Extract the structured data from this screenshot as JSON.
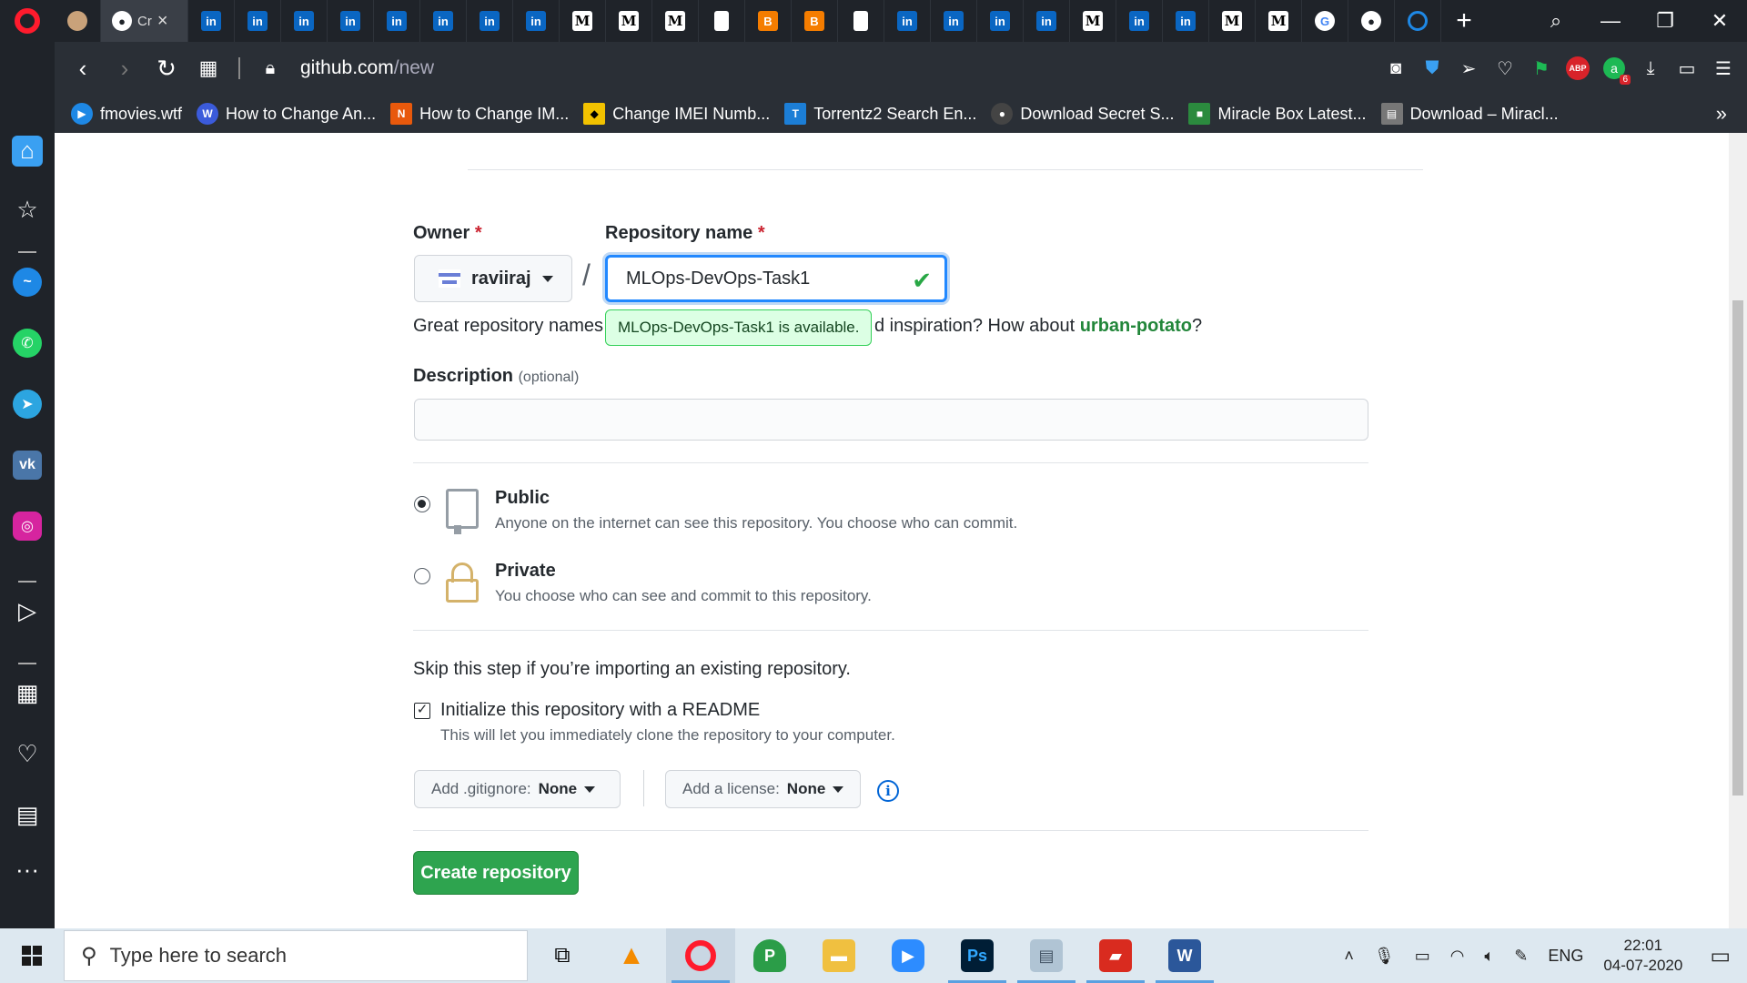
{
  "browser": {
    "active_tab_label": "Cr",
    "url_host": "github.com",
    "url_path": "/new",
    "extension_badge": "6",
    "abp_label": "ABP"
  },
  "tabs": [
    "avatar",
    "github",
    "linkedin",
    "linkedin",
    "linkedin",
    "linkedin",
    "linkedin",
    "linkedin",
    "linkedin",
    "linkedin",
    "medium",
    "medium",
    "medium",
    "doc",
    "blogger",
    "blogger",
    "doc",
    "linkedin",
    "linkedin",
    "linkedin",
    "linkedin",
    "medium",
    "linkedin",
    "linkedin",
    "medium",
    "medium",
    "google",
    "github",
    "power"
  ],
  "bookmarks": [
    {
      "label": "fmovies.wtf",
      "color": "#1e88e5"
    },
    {
      "label": "How to Change An...",
      "color": "#3b5bdb"
    },
    {
      "label": "How to Change IM...",
      "color": "#e8590c"
    },
    {
      "label": "Change IMEI Numb...",
      "color": "#f2c200"
    },
    {
      "label": "Torrentz2 Search En...",
      "color": "#1c7ed6"
    },
    {
      "label": "Download Secret S...",
      "color": "#444"
    },
    {
      "label": "Miracle Box Latest...",
      "color": "#2b8a3e"
    },
    {
      "label": "Download – Miracl...",
      "color": "#777"
    }
  ],
  "form": {
    "owner_label": "Owner",
    "required_mark": "*",
    "owner_value": "raviiraj",
    "separator": "/",
    "repo_name_label": "Repository name",
    "repo_name_value": "MLOps-DevOps-Task1",
    "availability_tooltip": "MLOps-DevOps-Task1 is available.",
    "hint_prefix": "Great repository names",
    "hint_middle": "d inspiration? How about ",
    "hint_suggestion": "urban-potato",
    "hint_suffix": "?",
    "description_label": "Description",
    "description_optional": "(optional)",
    "description_value": "",
    "public_title": "Public",
    "public_subtitle": "Anyone on the internet can see this repository. You choose who can commit.",
    "private_title": "Private",
    "private_subtitle": "You choose who can see and commit to this repository.",
    "skip_text": "Skip this step if you’re importing an existing repository.",
    "readme_label": "Initialize this repository with a README",
    "readme_subtitle": "This will let you immediately clone the repository to your computer.",
    "readme_checked": true,
    "gitignore_prefix": "Add .gitignore:",
    "gitignore_value": "None",
    "license_prefix": "Add a license:",
    "license_value": "None",
    "create_button": "Create repository"
  },
  "taskbar": {
    "search_placeholder": "Type here to search",
    "language": "ENG",
    "time": "22:01",
    "date": "04-07-2020"
  },
  "colors": {
    "primary_button": "#2ea44f",
    "focus_border": "#2188ff",
    "available_bg": "#dcffe4",
    "suggestion": "#22863a"
  }
}
